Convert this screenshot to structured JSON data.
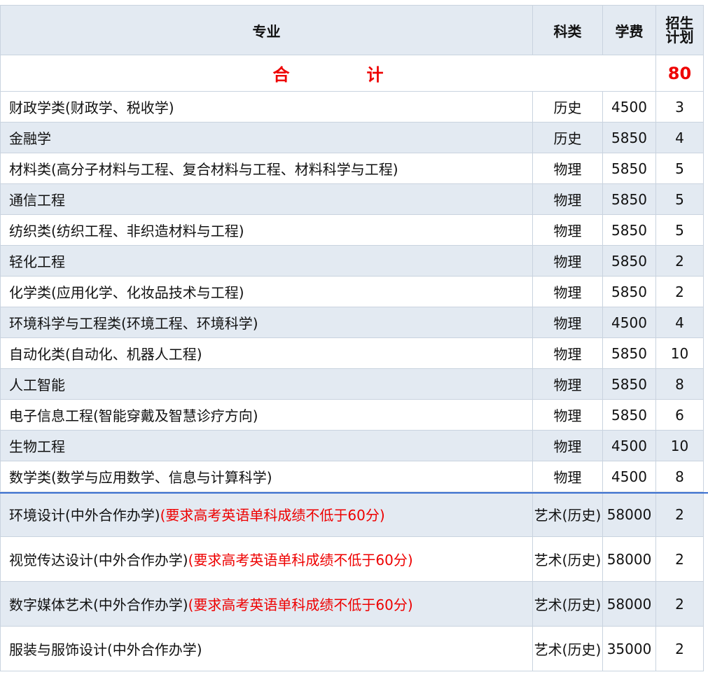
{
  "headers": {
    "major": "专业",
    "category": "科类",
    "fee": "学费",
    "plan_line1": "招生",
    "plan_line2": "计划"
  },
  "total": {
    "label_char1": "合",
    "label_char2": "计",
    "value": "80"
  },
  "rows": [
    {
      "major": "财政学类(财政学、税收学)",
      "note": "",
      "category": "历史",
      "fee": "4500",
      "plan": "3"
    },
    {
      "major": "金融学",
      "note": "",
      "category": "历史",
      "fee": "5850",
      "plan": "4"
    },
    {
      "major": "材料类(高分子材料与工程、复合材料与工程、材料科学与工程)",
      "note": "",
      "category": "物理",
      "fee": "5850",
      "plan": "5"
    },
    {
      "major": "通信工程",
      "note": "",
      "category": "物理",
      "fee": "5850",
      "plan": "5"
    },
    {
      "major": "纺织类(纺织工程、非织造材料与工程)",
      "note": "",
      "category": "物理",
      "fee": "5850",
      "plan": "5"
    },
    {
      "major": "轻化工程",
      "note": "",
      "category": "物理",
      "fee": "5850",
      "plan": "2"
    },
    {
      "major": "化学类(应用化学、化妆品技术与工程)",
      "note": "",
      "category": "物理",
      "fee": "5850",
      "plan": "2"
    },
    {
      "major": "环境科学与工程类(环境工程、环境科学)",
      "note": "",
      "category": "物理",
      "fee": "4500",
      "plan": "4"
    },
    {
      "major": "自动化类(自动化、机器人工程)",
      "note": "",
      "category": "物理",
      "fee": "5850",
      "plan": "10"
    },
    {
      "major": "人工智能",
      "note": "",
      "category": "物理",
      "fee": "5850",
      "plan": "8"
    },
    {
      "major": "电子信息工程(智能穿戴及智慧诊疗方向)",
      "note": "",
      "category": "物理",
      "fee": "5850",
      "plan": "6"
    },
    {
      "major": "生物工程",
      "note": "",
      "category": "物理",
      "fee": "4500",
      "plan": "10"
    },
    {
      "major": "数学类(数学与应用数学、信息与计算科学)",
      "note": "",
      "category": "物理",
      "fee": "4500",
      "plan": "8"
    },
    {
      "major": "环境设计(中外合作办学)",
      "note": "(要求高考英语单科成绩不低于60分)",
      "category": "艺术(历史)",
      "fee": "58000",
      "plan": "2"
    },
    {
      "major": "视觉传达设计(中外合作办学)",
      "note": "(要求高考英语单科成绩不低于60分)",
      "category": "艺术(历史)",
      "fee": "58000",
      "plan": "2"
    },
    {
      "major": "数字媒体艺术(中外合作办学)",
      "note": "(要求高考英语单科成绩不低于60分)",
      "category": "艺术(历史)",
      "fee": "58000",
      "plan": "2"
    },
    {
      "major": "服装与服饰设计(中外合作办学)",
      "note": "",
      "category": "艺术(历史)",
      "fee": "35000",
      "plan": "2"
    }
  ],
  "colors": {
    "header_bg": "#e3eaf2",
    "alt_row_bg": "#e3eaf2",
    "accent_red": "#ee0000",
    "border": "#c9d3df",
    "divider_blue": "#3a6fd0"
  }
}
